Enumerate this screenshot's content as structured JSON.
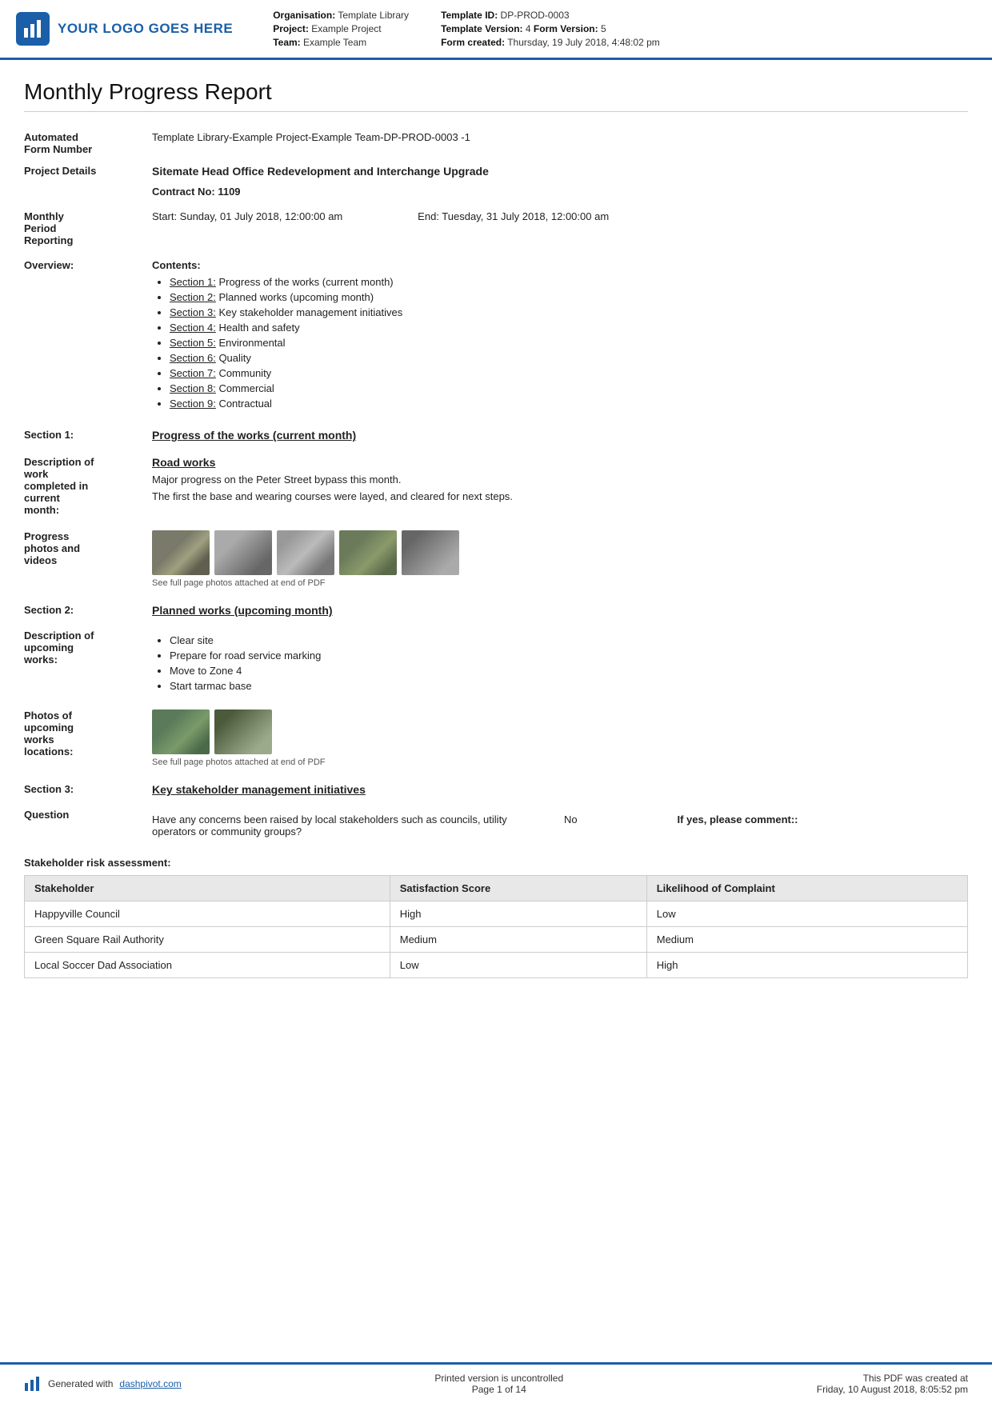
{
  "header": {
    "logo_text": "YOUR LOGO GOES HERE",
    "org_label": "Organisation:",
    "org_value": "Template Library",
    "project_label": "Project:",
    "project_value": "Example Project",
    "team_label": "Team:",
    "team_value": "Example Team",
    "template_id_label": "Template ID:",
    "template_id_value": "DP-PROD-0003",
    "template_version_label": "Template Version:",
    "template_version_value": "4",
    "form_version_label": "Form Version:",
    "form_version_value": "5",
    "form_created_label": "Form created:",
    "form_created_value": "Thursday, 19 July 2018, 4:48:02 pm"
  },
  "report": {
    "title": "Monthly Progress Report",
    "form_number_label": "Automated\nForm Number",
    "form_number_value": "Template Library-Example Project-Example Team-DP-PROD-0003   -1",
    "project_details_label": "Project Details",
    "project_details_value": "Sitemate Head Office Redevelopment and Interchange Upgrade",
    "contract_no_label": "",
    "contract_no_value": "Contract No: 1109",
    "monthly_period_label": "Monthly\nPeriod\nReporting",
    "monthly_period_start": "Start: Sunday, 01 July 2018, 12:00:00 am",
    "monthly_period_end": "End: Tuesday, 31 July 2018, 12:00:00 am",
    "overview_label": "Overview:",
    "contents_label": "Contents:",
    "contents_items": [
      {
        "link": "Section 1:",
        "text": " Progress of the works (current month)"
      },
      {
        "link": "Section 2:",
        "text": " Planned works (upcoming month)"
      },
      {
        "link": "Section 3:",
        "text": " Key stakeholder management initiatives"
      },
      {
        "link": "Section 4:",
        "text": " Health and safety"
      },
      {
        "link": "Section 5:",
        "text": " Environmental"
      },
      {
        "link": "Section 6:",
        "text": " Quality"
      },
      {
        "link": "Section 7:",
        "text": " Community"
      },
      {
        "link": "Section 8:",
        "text": " Commercial"
      },
      {
        "link": "Section 9:",
        "text": " Contractual"
      }
    ],
    "section1_label": "Section 1:",
    "section1_title": "Progress of the works (current month)",
    "desc_work_label": "Description of\nwork\ncompleted in\ncurrent\nmonth:",
    "road_works_title": "Road works",
    "road_works_desc1": "Major progress on the Peter Street bypass this month.",
    "road_works_desc2": "The first the base and wearing courses were layed, and cleared for next steps.",
    "progress_photos_label": "Progress\nphotos and\nvideos",
    "photos_caption": "See full page photos attached at end of PDF",
    "section2_label": "Section 2:",
    "section2_title": "Planned works (upcoming month)",
    "upcoming_works_label": "Description of\nupcoming\nworks:",
    "upcoming_works_items": [
      "Clear site",
      "Prepare for road service marking",
      "Move to Zone 4",
      "Start tarmac base"
    ],
    "upcoming_photos_label": "Photos of\nupcoming\nworks\nlocations:",
    "upcoming_photos_caption": "See full page photos attached at end of PDF",
    "section3_label": "Section 3:",
    "section3_title": "Key stakeholder management initiatives",
    "question_label": "Question",
    "question_text": "Have any concerns been raised by local stakeholders such as councils, utility operators or community groups?",
    "question_answer": "No",
    "question_if_yes": "If yes, please comment::",
    "stakeholder_section_label": "Stakeholder risk assessment:",
    "stakeholder_table": {
      "headers": [
        "Stakeholder",
        "Satisfaction Score",
        "Likelihood of Complaint"
      ],
      "rows": [
        [
          "Happyville Council",
          "High",
          "Low"
        ],
        [
          "Green Square Rail Authority",
          "Medium",
          "Medium"
        ],
        [
          "Local Soccer Dad Association",
          "Low",
          "High"
        ]
      ]
    }
  },
  "footer": {
    "generated_text": "Generated with",
    "link_text": "dashpivot.com",
    "middle_text": "Printed version is uncontrolled",
    "page_text": "Page 1 of 14",
    "right_text": "This PDF was created at\nFriday, 10 August 2018, 8:05:52 pm"
  }
}
